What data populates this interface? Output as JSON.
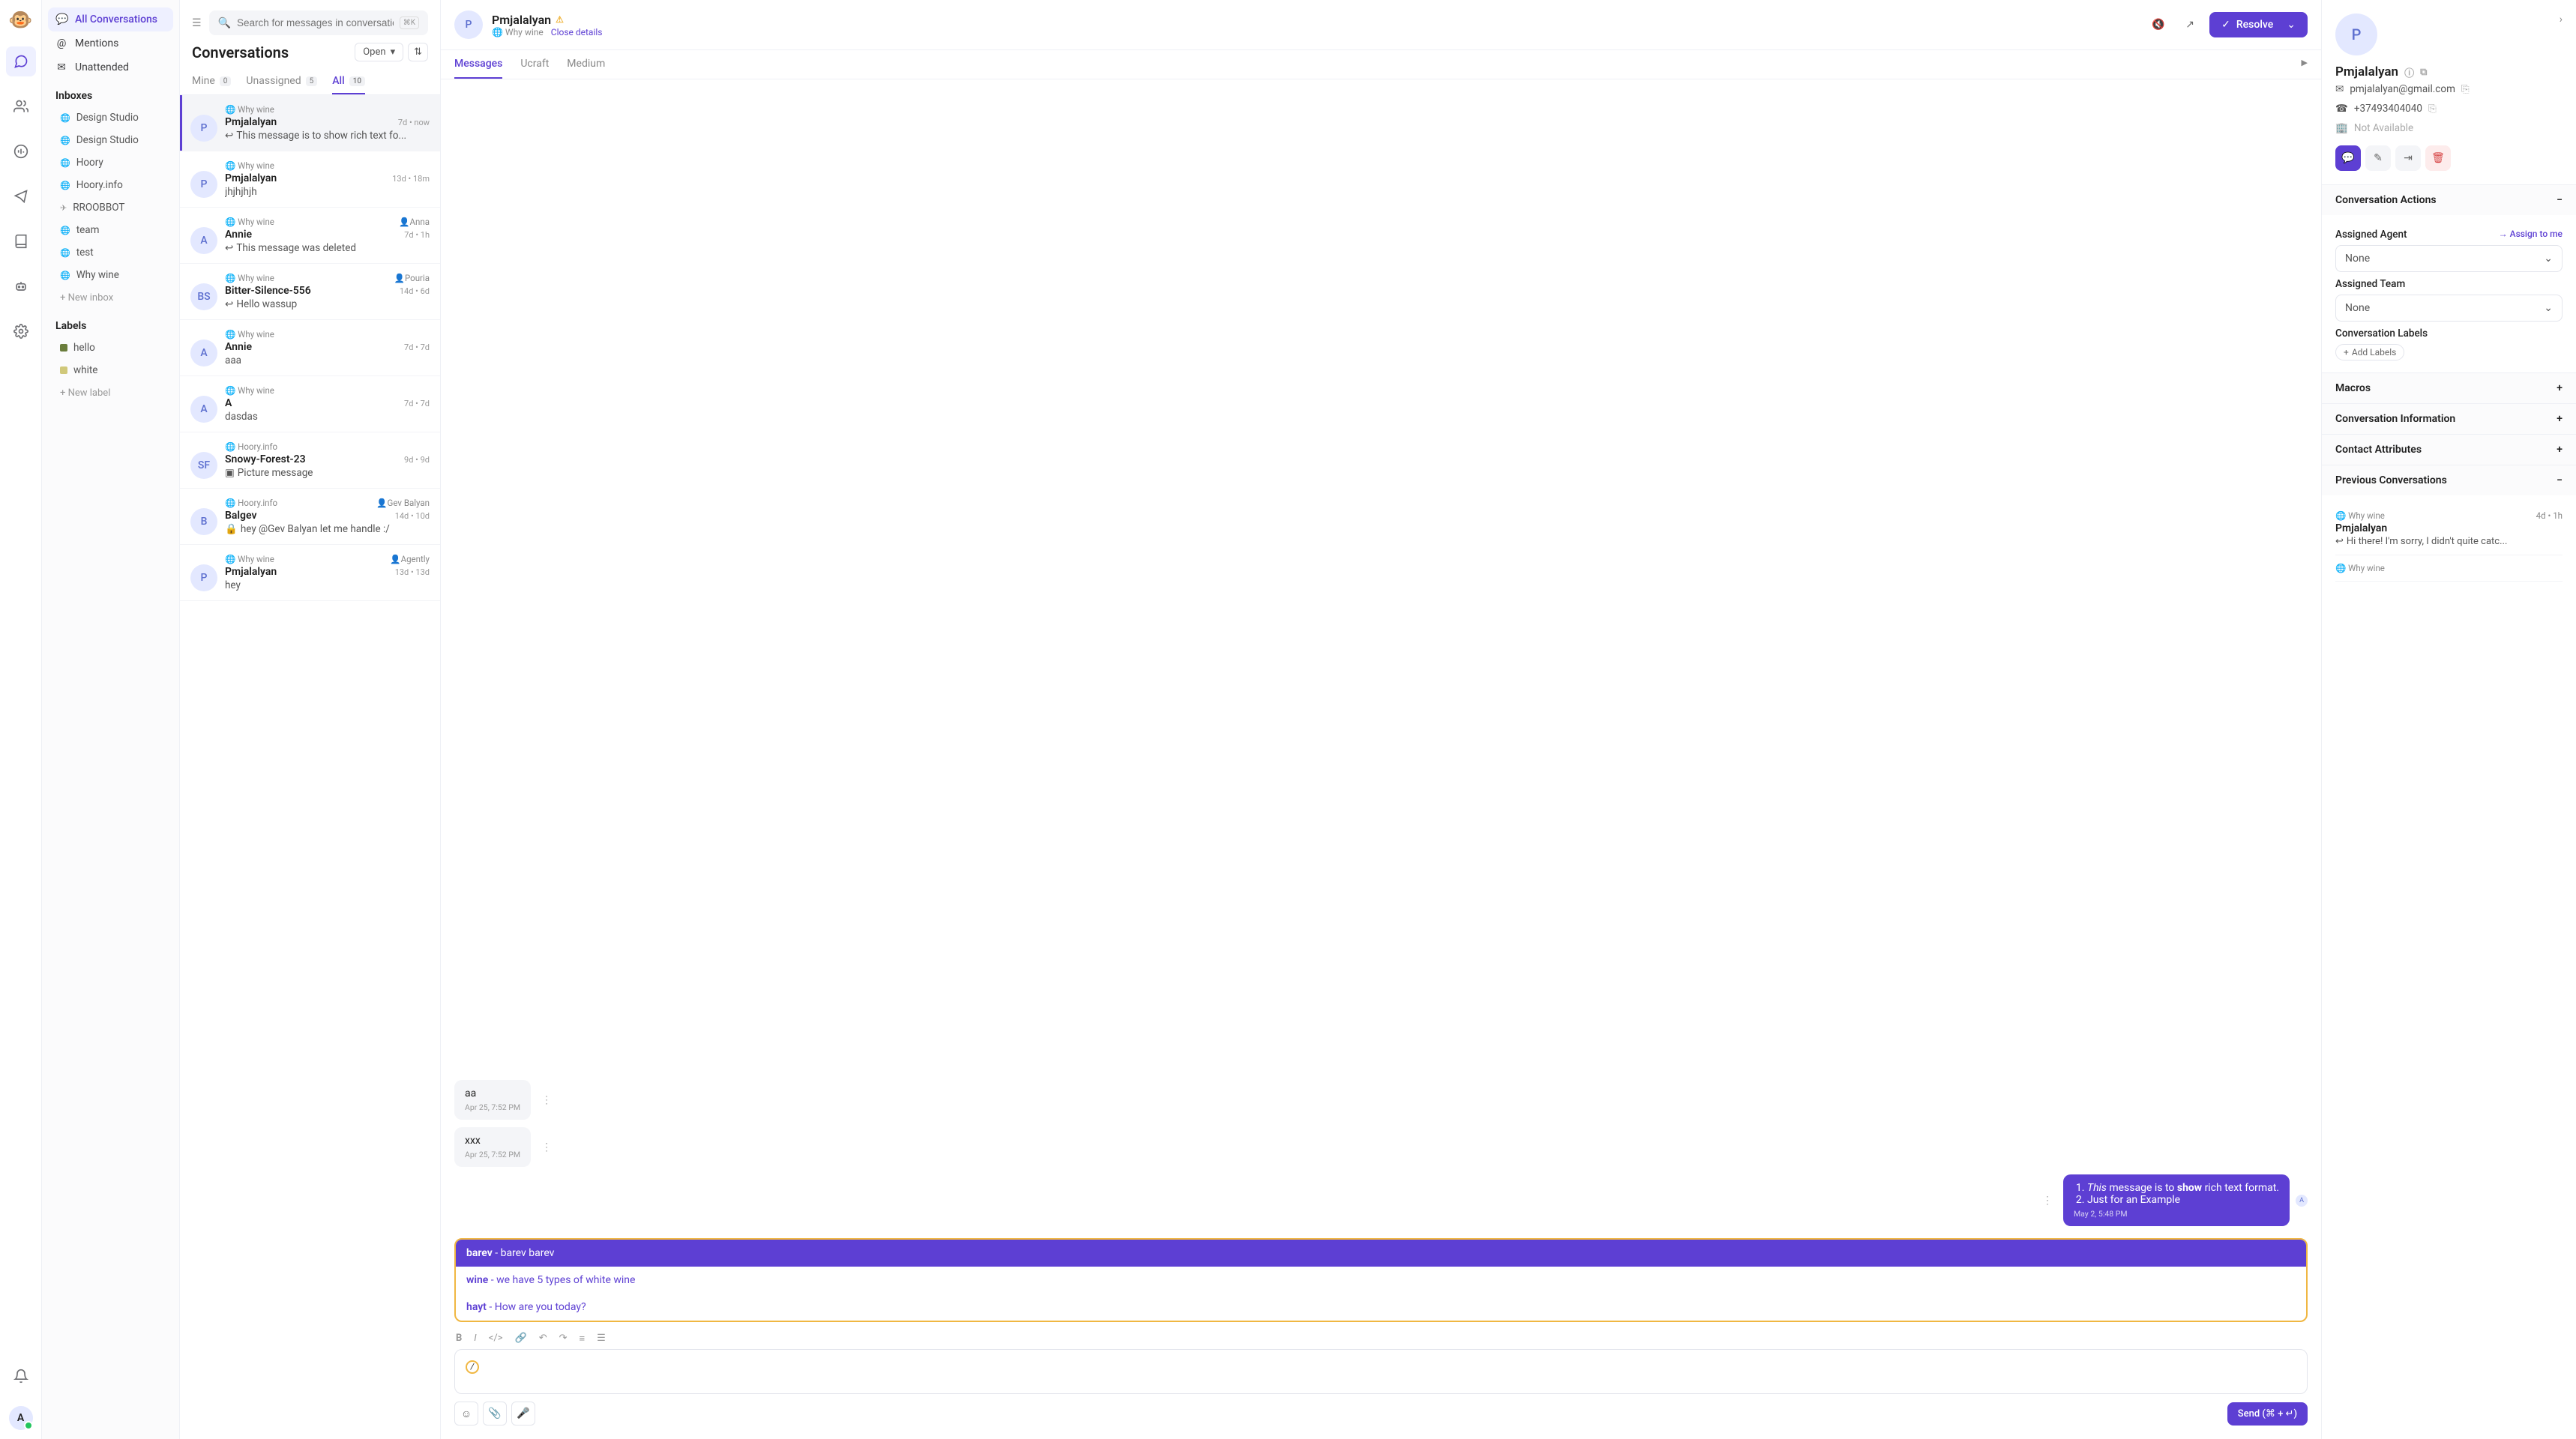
{
  "rail": {
    "logo": "🐵",
    "avatar_initial": "A"
  },
  "sidebar": {
    "main": [
      {
        "label": "All Conversations",
        "active": true
      },
      {
        "label": "Mentions"
      },
      {
        "label": "Unattended"
      }
    ],
    "inboxes_title": "Inboxes",
    "inboxes": [
      {
        "label": "Design Studio"
      },
      {
        "label": "Design Studio"
      },
      {
        "label": "Hoory"
      },
      {
        "label": "Hoory.info"
      },
      {
        "label": "RROOBBOT"
      },
      {
        "label": "team"
      },
      {
        "label": "test"
      },
      {
        "label": "Why wine"
      }
    ],
    "new_inbox": "New inbox",
    "labels_title": "Labels",
    "labels": [
      {
        "name": "hello",
        "color": "#6a7d3c"
      },
      {
        "name": "white",
        "color": "#d0c87a"
      }
    ],
    "new_label": "New label"
  },
  "convlist": {
    "search_placeholder": "Search for messages in conversations",
    "shortcut": "⌘K",
    "title": "Conversations",
    "dropdown": "Open",
    "tabs": [
      {
        "label": "Mine",
        "count": "0"
      },
      {
        "label": "Unassigned",
        "count": "5"
      },
      {
        "label": "All",
        "count": "10",
        "active": true
      }
    ],
    "items": [
      {
        "initial": "P",
        "inbox": "Why wine",
        "name": "Pmjalalyan",
        "time": "7d • now",
        "snippet": "This message is to show rich text fo...",
        "reply": true,
        "sel": true
      },
      {
        "initial": "P",
        "inbox": "Why wine",
        "name": "Pmjalalyan",
        "time": "13d • 18m",
        "snippet": "jhjhjhjh"
      },
      {
        "initial": "A",
        "inbox": "Why wine",
        "name": "Annie",
        "time": "7d • 1h",
        "snippet": "This message was deleted",
        "reply": true,
        "assignee": "Anna"
      },
      {
        "initial": "BS",
        "inbox": "Why wine",
        "name": "Bitter-Silence-556",
        "time": "14d • 6d",
        "snippet": "Hello wassup",
        "reply": true,
        "assignee": "Pouria"
      },
      {
        "initial": "A",
        "inbox": "Why wine",
        "name": "Annie",
        "time": "7d • 7d",
        "snippet": "aaa"
      },
      {
        "initial": "A",
        "inbox": "Why wine",
        "name": "A",
        "time": "7d • 7d",
        "snippet": "dasdas"
      },
      {
        "initial": "SF",
        "inbox": "Hoory.info",
        "name": "Snowy-Forest-23",
        "time": "9d • 9d",
        "snippet": "Picture message",
        "pic": true
      },
      {
        "initial": "B",
        "inbox": "Hoory.info",
        "name": "Balgev",
        "time": "14d • 10d",
        "snippet": "hey @Gev Balyan let me handle :/",
        "private": true,
        "assignee": "Gev Balyan"
      },
      {
        "initial": "P",
        "inbox": "Why wine",
        "name": "Pmjalalyan",
        "time": "13d • 13d",
        "snippet": "hey",
        "assignee": "Agently"
      }
    ]
  },
  "chat": {
    "initial": "P",
    "name": "Pmjalalyan",
    "inbox": "Why wine",
    "close": "Close details",
    "resolve": "Resolve",
    "tabs": [
      {
        "label": "Messages",
        "active": true
      },
      {
        "label": "Ucraft"
      },
      {
        "label": "Medium"
      }
    ],
    "msgs": [
      {
        "side": "in",
        "text": "aa",
        "time": "Apr 25, 7:52 PM"
      },
      {
        "side": "in",
        "text": "xxx",
        "time": "Apr 25, 7:52 PM"
      }
    ],
    "out_msg": {
      "line1_pre": "This",
      "line1_mid": " message is to ",
      "line1_bold": "show",
      "line1_post": " rich text format.",
      "line2": "Just for an Example",
      "time": "May 2, 5:48 PM",
      "av": "A"
    },
    "canned": [
      {
        "key": "barev",
        "desc": " - barev barev",
        "sel": true
      },
      {
        "key": "wine",
        "desc": " - we have 5 types of white wine"
      },
      {
        "key": "hayt",
        "desc": " - How are you today?"
      }
    ],
    "typed": "/",
    "send": "Send (⌘ + ↵)"
  },
  "details": {
    "initial": "P",
    "name": "Pmjalalyan",
    "email": "pmjalalyan@gmail.com",
    "phone": "+37493404040",
    "na": "Not Available",
    "sections": {
      "actions": "Conversation Actions",
      "agent_label": "Assigned Agent",
      "assign_me": "Assign to me",
      "agent_value": "None",
      "team_label": "Assigned Team",
      "team_value": "None",
      "labels": "Conversation Labels",
      "add_labels": "Add Labels",
      "macros": "Macros",
      "info": "Conversation Information",
      "attrs": "Contact Attributes",
      "prev": "Previous Conversations"
    },
    "prev": [
      {
        "inbox": "Why wine",
        "name": "Pmjalalyan",
        "time": "4d • 1h",
        "snippet": "Hi there! I'm sorry, I didn't quite catc..."
      },
      {
        "inbox": "Why wine"
      }
    ]
  }
}
